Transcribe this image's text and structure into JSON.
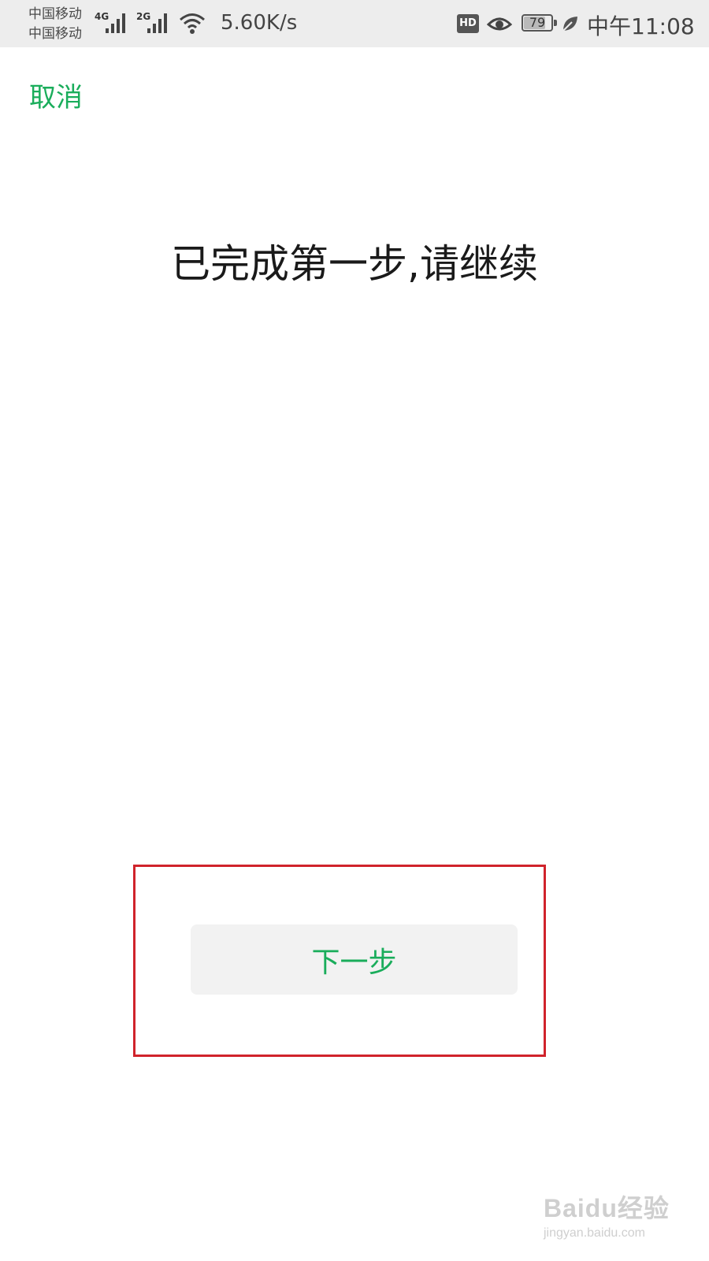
{
  "status_bar": {
    "carrier_1": "中国移动",
    "carrier_2": "中国移动",
    "network_1": "4G",
    "network_2": "2G",
    "speed": "5.60K/s",
    "hd_label": "HD",
    "battery": "79",
    "battery_level": 0.79,
    "time": "中午11:08",
    "icons": [
      "signal-icon",
      "wifi-icon",
      "eye-icon",
      "leaf-icon"
    ]
  },
  "nav": {
    "cancel_label": "取消"
  },
  "main": {
    "title": "已完成第一步,请继续"
  },
  "actions": {
    "next_label": "下一步"
  },
  "watermark": {
    "logo": "Baidu经验",
    "url": "jingyan.baidu.com"
  },
  "colors": {
    "accent": "#1aad5b",
    "highlight": "#d0232b",
    "button_bg": "#f2f2f2",
    "status_bg": "#ededed"
  }
}
